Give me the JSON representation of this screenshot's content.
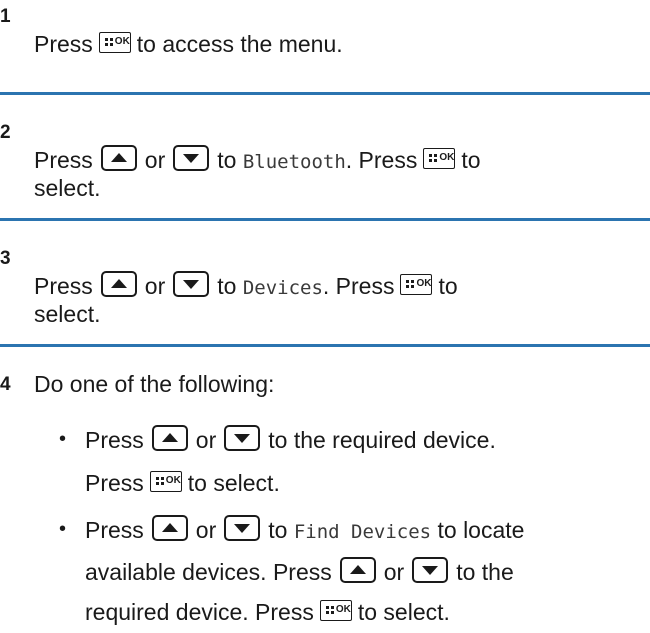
{
  "steps": [
    {
      "number": "1",
      "text_before": "Press",
      "text_after": "to access the menu."
    },
    {
      "number": "2",
      "press": "Press",
      "or": "or",
      "to": "to",
      "menu_item": "Bluetooth",
      "press2": ". Press",
      "to2": "to",
      "select": "select."
    },
    {
      "number": "3",
      "press": "Press",
      "or": "or",
      "to": "to",
      "menu_item": "Devices",
      "press2": ". Press",
      "to2": "to",
      "select": "select."
    },
    {
      "number": "4",
      "intro": "Do one of the following:",
      "bullets": [
        {
          "press": "Press",
          "or": "or",
          "rest": "to the required device.",
          "press2": "Press",
          "select": "to select."
        },
        {
          "press": "Press",
          "or": "or",
          "to": "to",
          "menu_item": "Find Devices",
          "rest": "to locate",
          "line2_a": "available devices. Press",
          "or2": "or",
          "line2_b": "to the",
          "line3_a": "required device. Press",
          "select": "to select."
        }
      ]
    }
  ],
  "icons": {
    "ok_label": "OK",
    "up": "up-arrow-key-icon",
    "down": "down-arrow-key-icon",
    "menu_ok": "menu-ok-key-icon"
  },
  "colors": {
    "rule": "#2b74b0",
    "text": "#1a1a1a"
  }
}
